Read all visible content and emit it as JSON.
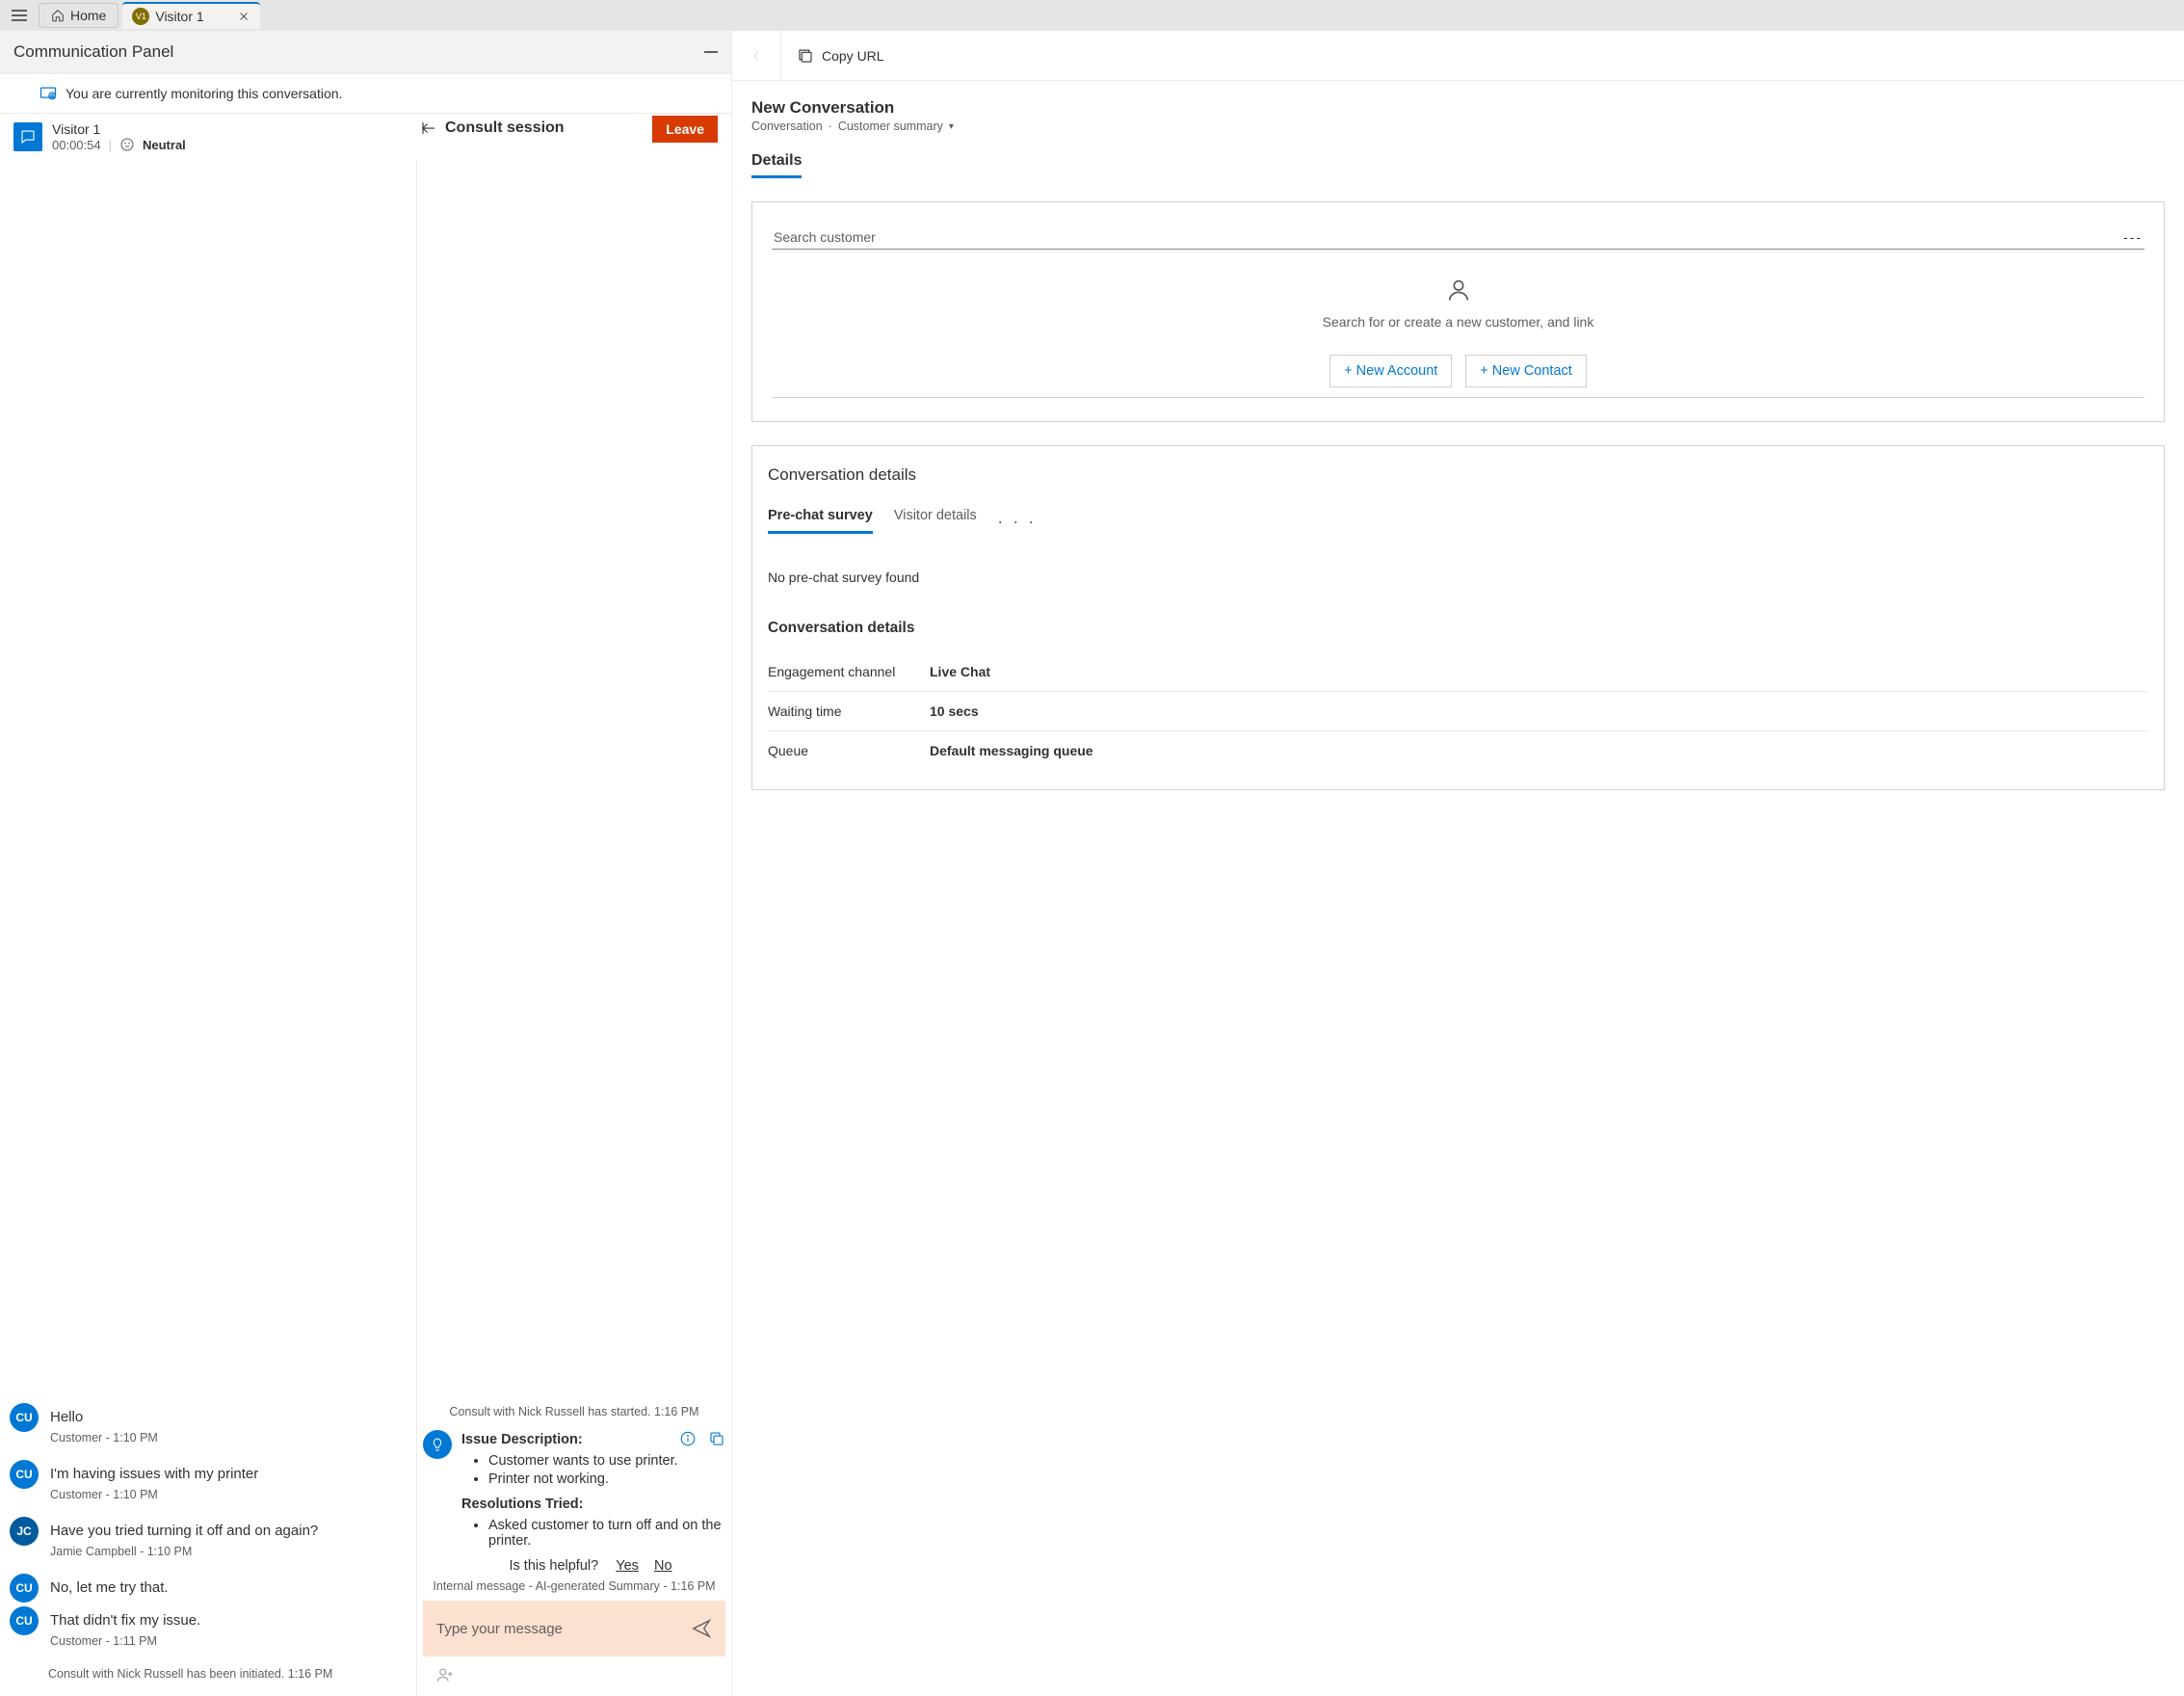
{
  "tabs": {
    "home": "Home",
    "active": "Visitor 1",
    "active_initials": "V1"
  },
  "comm_panel": {
    "title": "Communication Panel",
    "monitoring_msg": "You are currently monitoring this conversation."
  },
  "session": {
    "name": "Visitor 1",
    "timer": "00:00:54",
    "sentiment": "Neutral"
  },
  "consult": {
    "label": "Consult session",
    "leave": "Leave"
  },
  "chat": [
    {
      "initials": "CU",
      "text": "Hello",
      "meta": "Customer - 1:10 PM",
      "av": "cu"
    },
    {
      "initials": "CU",
      "text": "I'm having issues with my printer",
      "meta": "Customer - 1:10 PM",
      "av": "cu"
    },
    {
      "initials": "JC",
      "text": "Have you tried turning it off and on again?",
      "meta": "Jamie Campbell - 1:10 PM",
      "av": "jc"
    },
    {
      "initials": "CU",
      "text": "No, let me try that.",
      "meta": "",
      "av": "cu"
    },
    {
      "initials": "CU",
      "text": "That didn't fix my issue.",
      "meta": "Customer - 1:11 PM",
      "av": "cu"
    }
  ],
  "chat_system": "Consult with Nick Russell has been initiated. 1:16 PM",
  "ai": {
    "started": "Consult with Nick Russell has started. 1:16 PM",
    "issue_h": "Issue Description:",
    "issue": [
      "Customer wants to use printer.",
      "Printer not working."
    ],
    "res_h": "Resolutions Tried:",
    "res": [
      "Asked customer to turn off and on the printer."
    ],
    "feedback_q": "Is this helpful?",
    "yes": "Yes",
    "no": "No",
    "internal_meta": "Internal message - AI-generated Summary - 1:16 PM"
  },
  "compose": {
    "placeholder": "Type your message"
  },
  "right": {
    "copy_url": "Copy URL",
    "record_title": "New Conversation",
    "record_sub1": "Conversation",
    "record_sub2": "Customer summary",
    "details_tab": "Details",
    "search_label": "Search customer",
    "search_val": "---",
    "empty": "Search for or create a new customer, and link",
    "new_account": "+ New Account",
    "new_contact": "+ New Contact",
    "convo_title": "Conversation details",
    "inner_tabs": {
      "a": "Pre-chat survey",
      "b": "Visitor details"
    },
    "no_survey": "No pre-chat survey found",
    "sub_hdr": "Conversation details",
    "kv": [
      {
        "k": "Engagement channel",
        "v": "Live Chat"
      },
      {
        "k": "Waiting time",
        "v": "10 secs"
      },
      {
        "k": "Queue",
        "v": "Default messaging queue"
      }
    ]
  }
}
